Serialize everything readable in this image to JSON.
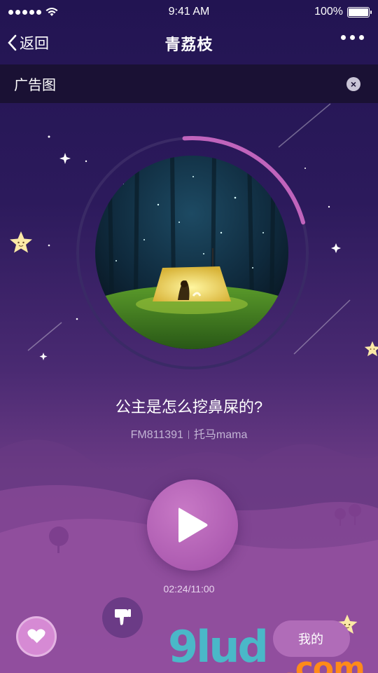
{
  "status_bar": {
    "carrier_signal": "signal-dots",
    "time": "9:41 AM",
    "battery": "100%",
    "battery_level": 1.0
  },
  "nav": {
    "back_label": "返回",
    "title": "青荔枝"
  },
  "ad": {
    "label": "广告图"
  },
  "track": {
    "title": "公主是怎么挖鼻屎的?",
    "station": "FM811391",
    "author": "托马mama",
    "progress_time": "02:24/11:00",
    "progress": 0.218
  },
  "bottom_bar": {
    "mine_label": "我的"
  },
  "watermark": {
    "part1": "9lud",
    "part2": ".com"
  },
  "colors": {
    "accent": "#b56bc0",
    "background_top": "#221452",
    "background_bottom": "#7e4492"
  },
  "icons": {
    "like": "heart-icon",
    "dislike": "thumbs-down-icon",
    "play": "play-icon",
    "close": "close-icon",
    "back": "chevron-left-icon",
    "more": "more-dots-icon"
  }
}
